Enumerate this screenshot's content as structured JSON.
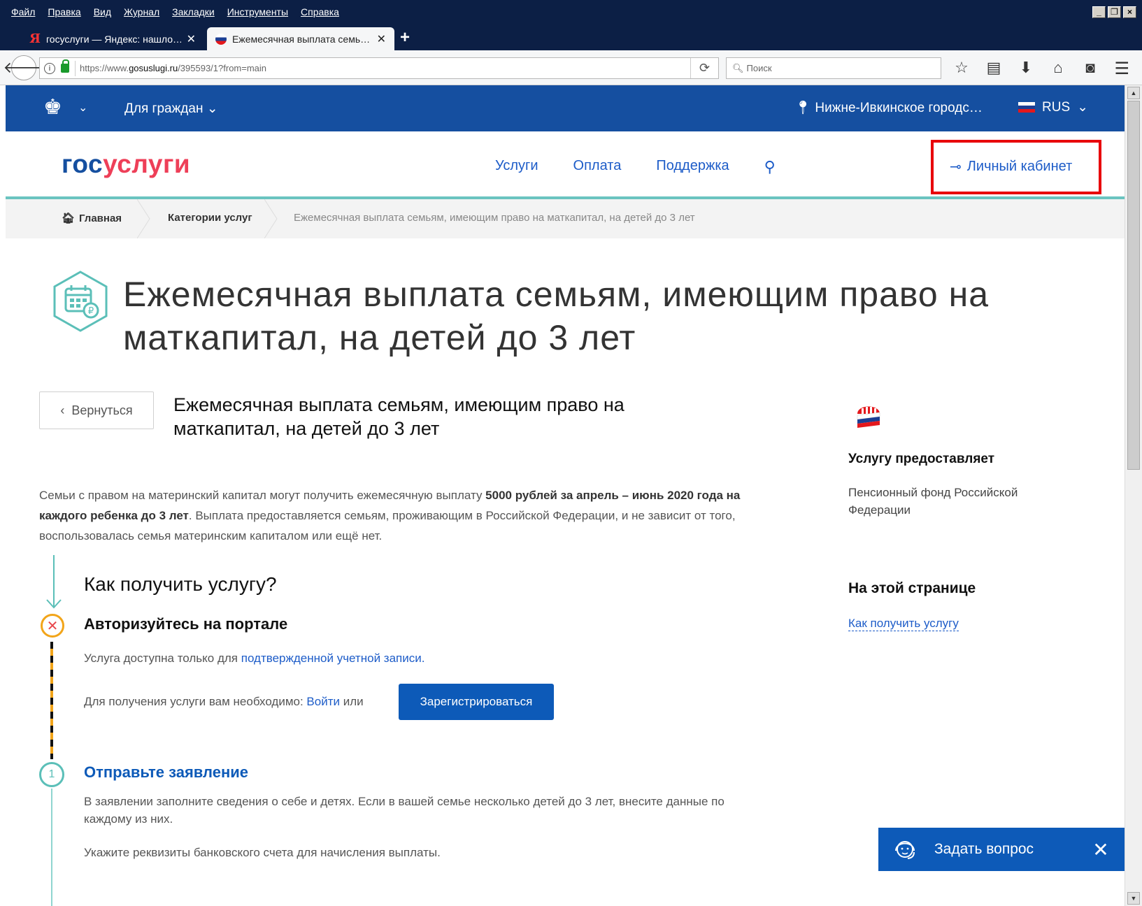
{
  "browser": {
    "menu": [
      "Файл",
      "Правка",
      "Вид",
      "Журнал",
      "Закладки",
      "Инструменты",
      "Справка"
    ],
    "tabs": [
      {
        "title": "госуслуги — Яндекс: нашло…",
        "active": false
      },
      {
        "title": "Ежемесячная выплата семь…",
        "active": true
      }
    ],
    "url_prefix": "https://www.",
    "url_domain": "gosuslugi.ru",
    "url_path": "/395593/1?from=main",
    "search_placeholder": "Поиск"
  },
  "topbar": {
    "citizens": "Для граждан",
    "location": "Нижне-Ивкинское городс…",
    "lang": "RUS"
  },
  "header": {
    "logo_gos": "гос",
    "logo_uslugi": "услуги",
    "nav": [
      "Услуги",
      "Оплата",
      "Поддержка"
    ],
    "cabinet": "Личный кабинет"
  },
  "breadcrumbs": {
    "home": "Главная",
    "categories": "Категории услуг",
    "current": "Ежемесячная выплата семьям, имеющим право на маткапитал, на детей до 3 лет"
  },
  "page": {
    "title": "Ежемесячная выплата семьям, имеющим право на маткапитал, на детей до 3 лет",
    "back": "Вернуться",
    "subtitle": "Ежемесячная выплата семьям, имеющим право на маткапитал, на детей до 3 лет",
    "intro_1": "Семьи с правом на материнский капитал могут получить ежемесячную выплату ",
    "intro_bold": "5000 рублей за апрель – июнь 2020 года на каждого ребенка до 3 лет",
    "intro_2": ". Выплата предоставляется семьям, проживающим в Российской Федерации, и не зависит от того, воспользовалась семья материнским капиталом или ещё нет.",
    "how_title": "Как получить услугу?",
    "step1_title": "Авторизуйтесь на портале",
    "step1_text": "Услуга доступна только для ",
    "step1_link": "подтвержденной учетной записи.",
    "step1_need": "Для получения услуги вам необходимо: ",
    "step1_login": "Войти",
    "step1_or": " или",
    "register": "Зарегистрироваться",
    "step2_number": "1",
    "step2_title": "Отправьте заявление",
    "step2_text": "В заявлении заполните сведения о себе и детях. Если в вашей семье несколько детей до 3 лет, внесите данные по каждому из них.",
    "step2_text2": "Укажите реквизиты банковского счета для начисления выплаты."
  },
  "sidebar": {
    "provider_label": "Услугу предоставляет",
    "provider_name": "Пенсионный фонд Российской Федерации",
    "onpage_label": "На этой странице",
    "onpage_link": "Как получить услугу"
  },
  "widget": {
    "ask": "Задать вопрос"
  },
  "colors": {
    "topbar": "#154fa0",
    "accent_red": "#ee3f58",
    "link": "#1d5cc8",
    "teal": "#5bbfb8",
    "highlight": "#e8000b"
  }
}
